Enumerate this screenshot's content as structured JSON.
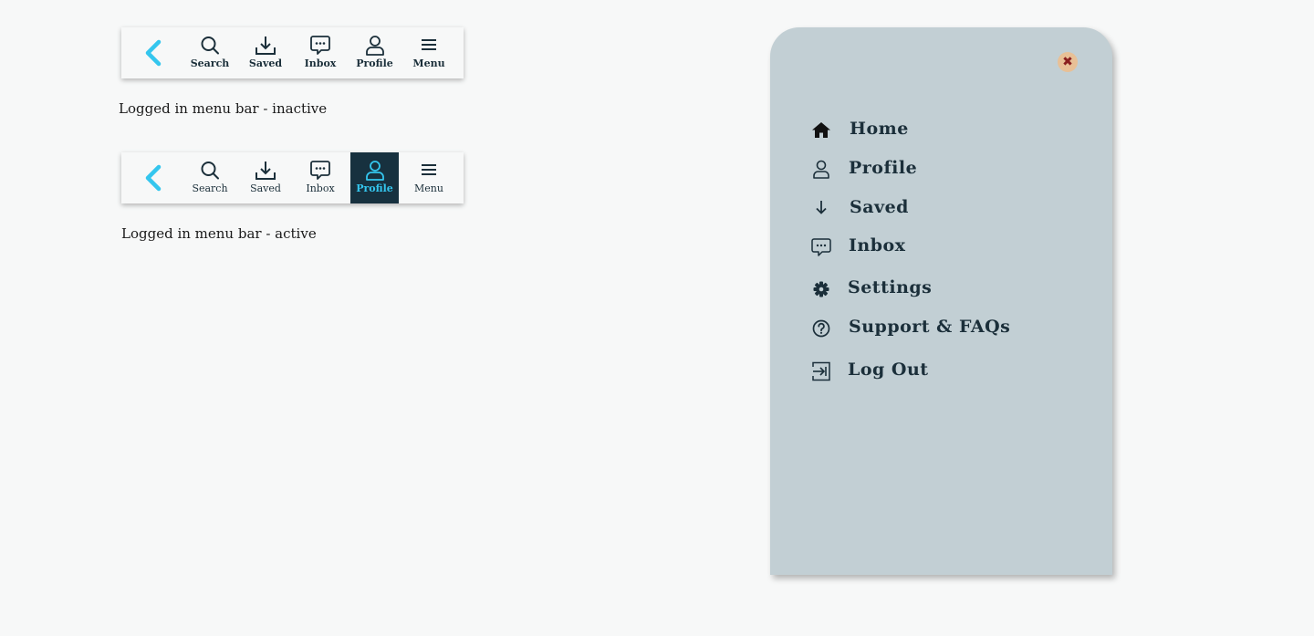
{
  "menubar_inactive": {
    "back_icon": "chevron-left-icon",
    "items": [
      {
        "label": "Search",
        "icon": "search-icon"
      },
      {
        "label": "Saved",
        "icon": "download-icon"
      },
      {
        "label": "Inbox",
        "icon": "chat-bubble-icon"
      },
      {
        "label": "Profile",
        "icon": "user-icon"
      },
      {
        "label": "Menu",
        "icon": "hamburger-icon"
      }
    ],
    "caption": "Logged in menu bar - inactive"
  },
  "menubar_active": {
    "back_icon": "chevron-left-icon",
    "items": [
      {
        "label": "Search",
        "icon": "search-icon"
      },
      {
        "label": "Saved",
        "icon": "download-icon"
      },
      {
        "label": "Inbox",
        "icon": "chat-bubble-icon"
      },
      {
        "label": "Profile",
        "icon": "user-icon",
        "active": true
      },
      {
        "label": "Menu",
        "icon": "hamburger-icon"
      }
    ],
    "caption": "Logged in menu bar - active"
  },
  "drawer": {
    "close_icon": "close-icon",
    "items": [
      {
        "label": "Home",
        "icon": "home-icon"
      },
      {
        "label": "Profile",
        "icon": "user-icon"
      },
      {
        "label": "Saved",
        "icon": "arrow-down-icon"
      },
      {
        "label": "Inbox",
        "icon": "chat-bubble-icon"
      },
      {
        "label": "Settings",
        "icon": "gear-icon"
      },
      {
        "label": "Support & FAQs",
        "icon": "help-circle-icon"
      },
      {
        "label": "Log Out",
        "icon": "logout-icon"
      }
    ]
  },
  "colors": {
    "accent": "#34c6ee",
    "dark": "#17313f",
    "text": "#1b2f3a",
    "drawer_bg": "#c2cfd4",
    "page_bg": "#f7f8f8",
    "close_bg": "#e8c096",
    "close_fg": "#8a1f1f"
  }
}
